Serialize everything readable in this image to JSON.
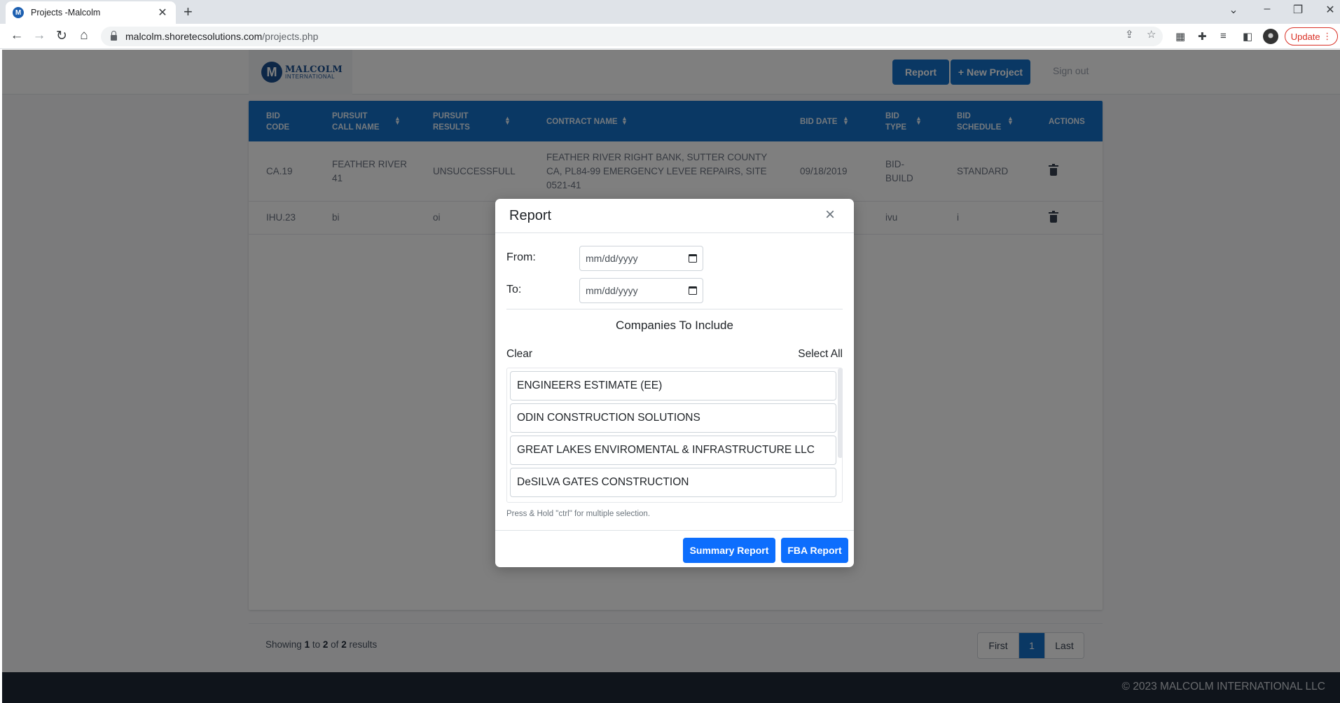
{
  "browser": {
    "tab_title": "Projects -Malcolm",
    "favicon_letter": "M",
    "new_tab": "+",
    "url_host": "malcolm.shoretecsolutions.com",
    "url_path": "/projects.php",
    "update_label": "Update"
  },
  "header": {
    "logo_main": "MALCOLM",
    "logo_sub": "INTERNATIONAL",
    "logo_seal": "M",
    "report_label": "Report",
    "new_project_label": "+ New Project",
    "signout_label": "Sign out"
  },
  "table": {
    "columns": [
      "BID CODE",
      "PURSUIT CALL NAME",
      "PURSUIT RESULTS",
      "CONTRACT NAME",
      "BID DATE",
      "BID TYPE",
      "BID SCHEDULE",
      "ACTIONS"
    ],
    "rows": [
      {
        "bid_code": "CA.19",
        "call_name": "FEATHER RIVER 41",
        "results": "UNSUCCESSFULL",
        "contract_name": "FEATHER RIVER RIGHT BANK, SUTTER COUNTY CA, PL84-99 EMERGENCY LEVEE REPAIRS, SITE 0521-41",
        "bid_date": "09/18/2019",
        "bid_type": "BID-BUILD",
        "bid_schedule": "STANDARD"
      },
      {
        "bid_code": "IHU.23",
        "call_name": "bi",
        "results": "oi",
        "contract_name": "",
        "bid_date": "",
        "bid_type": "ivu",
        "bid_schedule": "i"
      }
    ]
  },
  "pagination": {
    "showing_prefix": "Showing",
    "from": "1",
    "to_word": "to",
    "to": "2",
    "of_word": "of",
    "total": "2",
    "results_word": "results",
    "first": "First",
    "current": "1",
    "last": "Last"
  },
  "footer": {
    "copyright": "© 2023 MALCOLM INTERNATIONAL LLC"
  },
  "modal": {
    "title": "Report",
    "close": "×",
    "from_label": "From:",
    "to_label": "To:",
    "date_placeholder": "mm/dd/yyyy",
    "companies_title": "Companies To Include",
    "clear_label": "Clear",
    "select_all_label": "Select All",
    "companies": [
      "ENGINEERS ESTIMATE (EE)",
      "ODIN CONSTRUCTION SOLUTIONS",
      "GREAT LAKES ENVIROMENTAL & INFRASTRUCTURE LLC",
      "DeSILVA GATES CONSTRUCTION"
    ],
    "help_text": "Press & Hold \"ctrl\" for multiple selection.",
    "summary_report_label": "Summary Report",
    "fba_report_label": "FBA Report"
  }
}
